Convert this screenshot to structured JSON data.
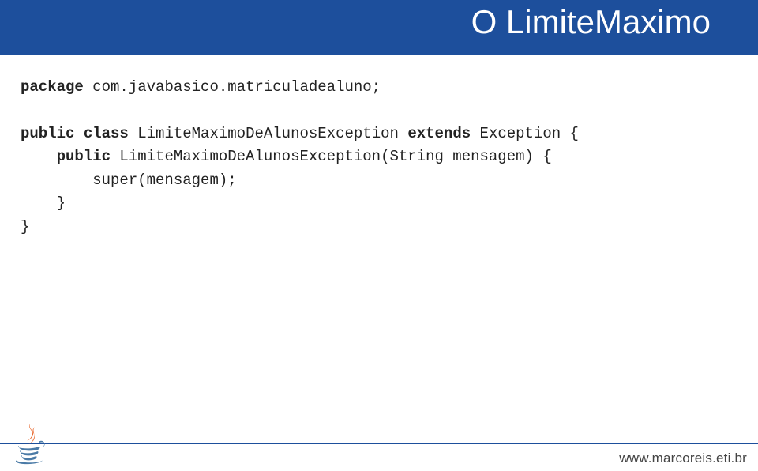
{
  "header": {
    "title": "O LimiteMaximo"
  },
  "code": {
    "kw_package": "package",
    "package_rest": " com.javabasico.matriculadealuno;",
    "kw_public1": "public",
    "kw_class": " class",
    "class_rest": " LimiteMaximoDeAlunosException ",
    "kw_extends": "extends",
    "extends_rest": " Exception {",
    "indent1": "    ",
    "kw_public2": "public",
    "ctor_rest": " LimiteMaximoDeAlunosException(String mensagem) {",
    "indent2": "        ",
    "super_line": "super(mensagem);",
    "indent_close1": "    ",
    "close1": "}",
    "close2": "}"
  },
  "footer": {
    "url": "www.marcoreis.eti.br"
  }
}
